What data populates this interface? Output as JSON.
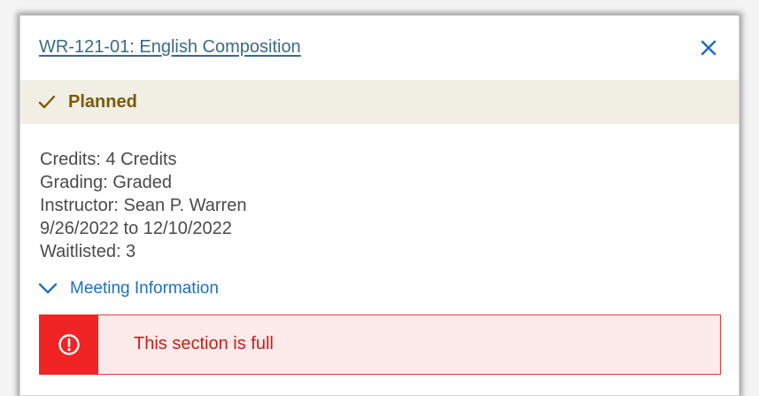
{
  "card": {
    "title": "WR-121-01: English Composition",
    "close_icon": "close-icon",
    "status": {
      "label": "Planned",
      "icon": "checkmark-icon",
      "color": "#7a5a0a",
      "background": "#f1efe4"
    },
    "details": {
      "credits": "Credits: 4 Credits",
      "grading": "Grading: Graded",
      "instructor": "Instructor: Sean P. Warren",
      "dates": "9/26/2022 to 12/10/2022",
      "waitlisted": "Waitlisted:  3"
    },
    "meeting_toggle": {
      "label": "Meeting Information",
      "icon": "chevron-down-icon"
    },
    "alert": {
      "message": "This section is full",
      "icon": "exclamation-circle-icon",
      "accent_color": "#f02424"
    }
  },
  "colors": {
    "link": "#3a6b84",
    "accent_blue": "#1f6fbf"
  }
}
